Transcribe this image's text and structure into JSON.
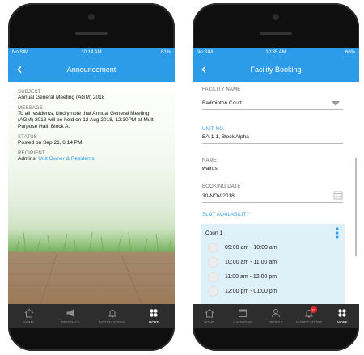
{
  "phone1": {
    "status": {
      "carrier": "No SIM",
      "time": "10:14 AM",
      "battery": "61%"
    },
    "title": "Announcement",
    "back_icon": "chevron-left-icon",
    "subject_label": "SUBJECT",
    "subject": "Annual General Meeting (AGM) 2018",
    "message_label": "MESSAGE",
    "message_lines": [
      "To all residents, kindly note that Annual General Meeting",
      "(AGM) 2018 will be held on 12 Aug 2018, 12:30PM at Multi",
      "Purpose Hall, Block A."
    ],
    "status_label": "STATUS",
    "status_value": "Posted on Sep 21, 6:14 PM.",
    "recipient_label": "RECIPIENT",
    "recipient_prefix": "Admins,",
    "recipient_link": "Unit Owner & Residents",
    "tabs": [
      {
        "label": "HOME",
        "icon": "home-icon",
        "active": false
      },
      {
        "label": "FEEDBACK",
        "icon": "megaphone-icon",
        "active": false
      },
      {
        "label": "NOTIFICATIONS",
        "icon": "bell-icon",
        "active": false
      },
      {
        "label": "MORE",
        "icon": "grid-dots-icon",
        "active": true
      }
    ]
  },
  "phone2": {
    "status": {
      "carrier": "No SIM",
      "time": "10:35 AM",
      "battery": "66%"
    },
    "title": "Facility Booking",
    "back_icon": "chevron-left-icon",
    "facility_label": "FACILITY NAME",
    "facility_value": "Badminton Court",
    "unit_label": "UNIT NO.",
    "unit_value": "BA-1-1, Block Alpha",
    "name_label": "NAME",
    "name_value": "walrus",
    "date_label": "BOOKING DATE",
    "date_value": "30-NOV-2018",
    "slot_label": "SLOT AVAILABILITY",
    "court": "Court 1",
    "slots": [
      "09:00 am - 10:00 am",
      "10:00 am - 11:00 am",
      "11:00 am - 12:00 pm",
      "12:00 pm - 01:00 pm"
    ],
    "notification_count": "27",
    "tabs": [
      {
        "label": "HOME",
        "icon": "home-icon",
        "active": false
      },
      {
        "label": "CALENDAR",
        "icon": "calendar-icon",
        "active": false
      },
      {
        "label": "PROFILE",
        "icon": "person-icon",
        "active": false
      },
      {
        "label": "NOTIFICATIONS",
        "icon": "bell-icon",
        "active": false
      },
      {
        "label": "MORE",
        "icon": "grid-dots-icon",
        "active": true
      }
    ]
  },
  "colors": {
    "accent": "#2c9ce8",
    "tabbar": "#2d2d2d",
    "slot_bg": "#dff1f8"
  }
}
